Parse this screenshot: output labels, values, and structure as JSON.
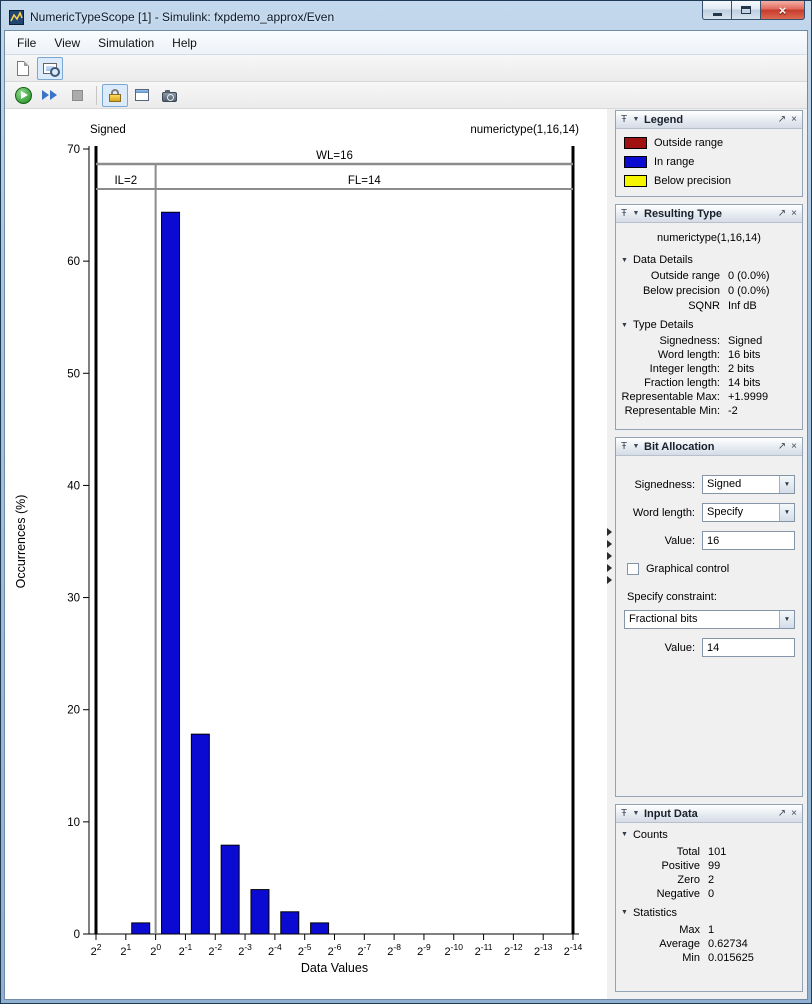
{
  "window": {
    "title": "NumericTypeScope [1] - Simulink: fxpdemo_approx/Even",
    "menus": [
      "File",
      "View",
      "Simulation",
      "Help"
    ]
  },
  "toolbar": {
    "standard_icons": [
      "new-report-icon",
      "highlight-simulink-signal-icon"
    ],
    "simulation_icons": [
      "run-icon",
      "step-forward-icon",
      "stop-icon",
      "lock-panels-icon",
      "signal-dialog-icon",
      "snapshot-icon"
    ],
    "lock_button_pressed": true
  },
  "chart_data": {
    "type": "bar",
    "title": "",
    "xlabel": "Data Values",
    "ylabel": "Occurrences (%)",
    "ylim": [
      0,
      70
    ],
    "y_ticks": [
      0,
      10,
      20,
      30,
      40,
      50,
      60,
      70
    ],
    "x_tick_base": "2",
    "x_tick_exponents": [
      2,
      1,
      0,
      -1,
      -2,
      -3,
      -4,
      -5,
      -6,
      -7,
      -8,
      -9,
      -10,
      -11,
      -12,
      -13,
      -14
    ],
    "bars_note": "each bar fills the bin between adjacent power-of-two ticks; hi_tick_index is the index into x_tick_exponents of the bin's upper power",
    "bars": [
      {
        "bin": "[2^0, 2^1)",
        "hi_tick_index": 1,
        "percent": 0.99
      },
      {
        "bin": "[2^-1, 2^0)",
        "hi_tick_index": 2,
        "percent": 64.36
      },
      {
        "bin": "[2^-2, 2^-1)",
        "hi_tick_index": 3,
        "percent": 17.82
      },
      {
        "bin": "[2^-3, 2^-2)",
        "hi_tick_index": 4,
        "percent": 7.92
      },
      {
        "bin": "[2^-4, 2^-3)",
        "hi_tick_index": 5,
        "percent": 3.96
      },
      {
        "bin": "[2^-5, 2^-4)",
        "hi_tick_index": 6,
        "percent": 1.98
      },
      {
        "bin": "[2^-6, 2^-5)",
        "hi_tick_index": 7,
        "percent": 0.99
      }
    ],
    "annotations": {
      "top_left": "Signed",
      "top_right": "numerictype(1,16,14)",
      "word_length": "WL=16",
      "integer_length": "IL=2",
      "fraction_length": "FL=14",
      "range_line_tick_indices": [
        0,
        16
      ],
      "binary_point_tick_index": 2
    },
    "colors": {
      "in_range": "#0a0ad2",
      "outside_range": "#a01212",
      "below_precision": "#f5f500",
      "annotation_line": "#8c8c8c"
    },
    "legend_position": "right-panel",
    "grid": false
  },
  "legend": {
    "title": "Legend",
    "items": [
      {
        "label": "Outside range",
        "color": "#a01212"
      },
      {
        "label": "In range",
        "color": "#0a0ad2"
      },
      {
        "label": "Below precision",
        "color": "#f5f500"
      }
    ]
  },
  "resulting_type": {
    "title": "Resulting Type",
    "numerictype": "numerictype(1,16,14)",
    "data_details": {
      "title": "Data Details",
      "rows": [
        {
          "label": "Outside range",
          "value": "0 (0.0%)"
        },
        {
          "label": "Below precision",
          "value": "0 (0.0%)"
        },
        {
          "label": "SQNR",
          "value": "Inf dB"
        }
      ]
    },
    "type_details": {
      "title": "Type Details",
      "rows": [
        {
          "label": "Signedness:",
          "value": "Signed"
        },
        {
          "label": "Word length:",
          "value": "16 bits"
        },
        {
          "label": "Integer length:",
          "value": "2 bits"
        },
        {
          "label": "Fraction length:",
          "value": "14 bits"
        },
        {
          "label": "Representable Max:",
          "value": "+1.9999"
        },
        {
          "label": "Representable Min:",
          "value": "-2"
        }
      ]
    }
  },
  "bit_allocation": {
    "title": "Bit Allocation",
    "signedness_label": "Signedness:",
    "signedness_value": "Signed",
    "word_length_label": "Word length:",
    "word_length_value": "Specify",
    "value_label": "Value:",
    "word_length_bits": "16",
    "graphical_control_label": "Graphical control",
    "graphical_control_checked": false,
    "specify_constraint_label": "Specify constraint:",
    "constraint_value": "Fractional bits",
    "fraction_value_label": "Value:",
    "fraction_bits": "14"
  },
  "input_data": {
    "title": "Input Data",
    "counts": {
      "title": "Counts",
      "rows": [
        {
          "label": "Total",
          "value": "101"
        },
        {
          "label": "Positive",
          "value": "99"
        },
        {
          "label": "Zero",
          "value": "2"
        },
        {
          "label": "Negative",
          "value": "0"
        }
      ]
    },
    "statistics": {
      "title": "Statistics",
      "rows": [
        {
          "label": "Max",
          "value": "1"
        },
        {
          "label": "Average",
          "value": "0.62734"
        },
        {
          "label": "Min",
          "value": "0.015625"
        }
      ]
    }
  }
}
